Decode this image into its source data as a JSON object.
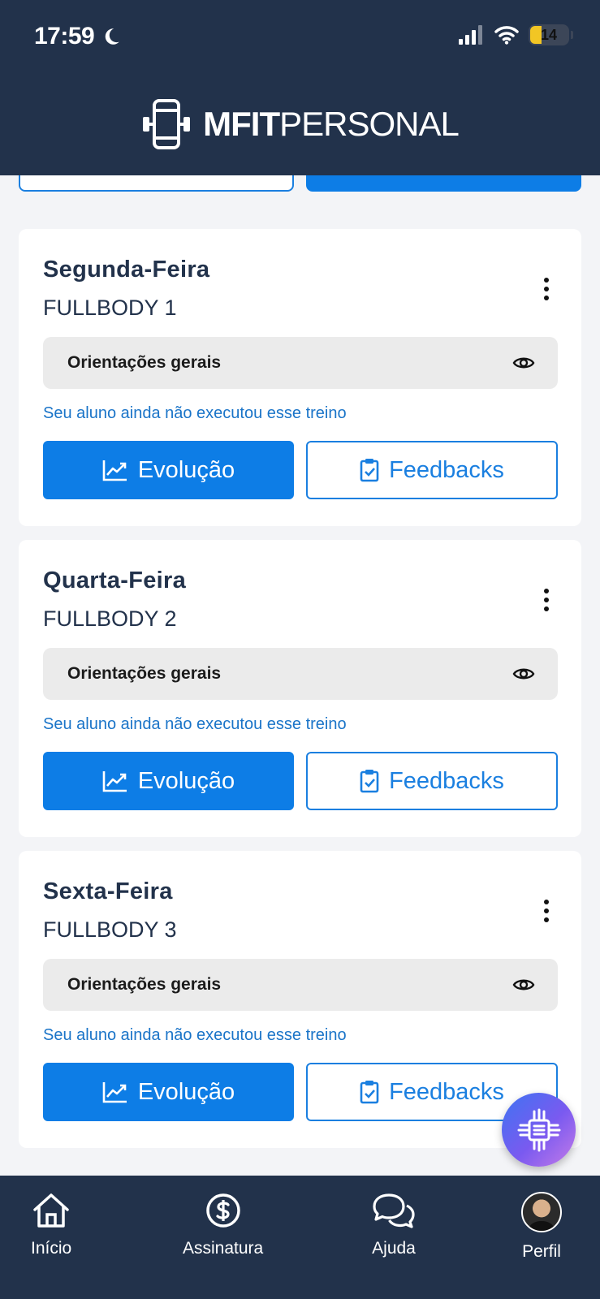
{
  "status_bar": {
    "time": "17:59",
    "battery": "14"
  },
  "brand": {
    "bold": "MFIT",
    "light": "PERSONAL"
  },
  "workouts": [
    {
      "day": "Segunda-Feira",
      "name": "FULLBODY 1",
      "guidelines_label": "Orientações gerais",
      "status_note": "Seu aluno ainda não executou esse treino",
      "evolution_label": "Evolução",
      "feedbacks_label": "Feedbacks"
    },
    {
      "day": "Quarta-Feira",
      "name": "FULLBODY 2",
      "guidelines_label": "Orientações gerais",
      "status_note": "Seu aluno ainda não executou esse treino",
      "evolution_label": "Evolução",
      "feedbacks_label": "Feedbacks"
    },
    {
      "day": "Sexta-Feira",
      "name": "FULLBODY 3",
      "guidelines_label": "Orientações gerais",
      "status_note": "Seu aluno ainda não executou esse treino",
      "evolution_label": "Evolução",
      "feedbacks_label": "Feedbacks"
    }
  ],
  "tabbar": {
    "items": [
      {
        "label": "Início",
        "icon": "home-icon"
      },
      {
        "label": "Assinatura",
        "icon": "dollar-circle-icon"
      },
      {
        "label": "Ajuda",
        "icon": "chat-bubbles-icon"
      },
      {
        "label": "Perfil",
        "icon": "avatar"
      }
    ]
  },
  "colors": {
    "header": "#22324b",
    "primary": "#0d7de6",
    "note": "#1a74c8",
    "panel": "#ebebeb"
  }
}
